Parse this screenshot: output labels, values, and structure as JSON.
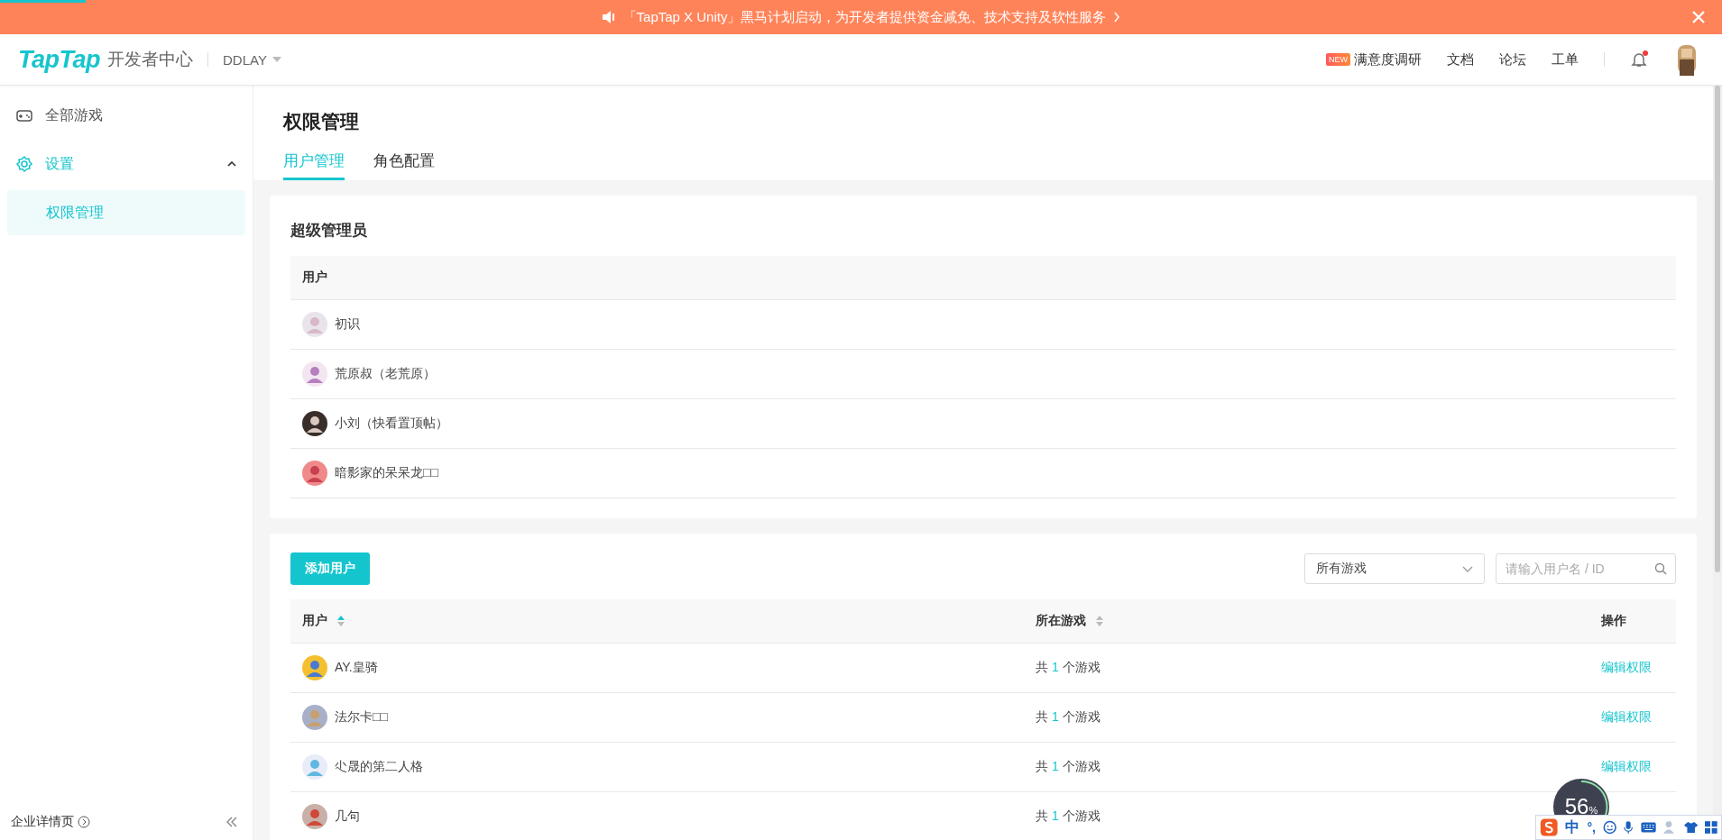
{
  "loading_bar": {
    "level": 0.05
  },
  "banner": {
    "text": "「TapTap X Unity」黑马计划启动，为开发者提供资金减免、技术支持及软性服务"
  },
  "header": {
    "logo": "TapTap",
    "subtitle": "开发者中心",
    "account": "DDLAY",
    "nav": [
      {
        "label": "满意度调研",
        "badge": "NEW"
      },
      {
        "label": "文档"
      },
      {
        "label": "论坛"
      },
      {
        "label": "工单"
      }
    ],
    "notification_dot": true
  },
  "sidebar": {
    "items": [
      {
        "label": "全部游戏",
        "kind": "link",
        "selected": false
      },
      {
        "label": "设置",
        "kind": "group",
        "selected": true,
        "expanded": true,
        "children": [
          {
            "label": "权限管理",
            "selected": true
          }
        ]
      }
    ],
    "footer": "企业详情页"
  },
  "page": {
    "title": "权限管理",
    "tabs": [
      {
        "label": "用户管理",
        "selected": true
      },
      {
        "label": "角色配置",
        "selected": false
      }
    ]
  },
  "super_admins": {
    "title": "超级管理员",
    "column": "用户",
    "rows": [
      {
        "name": "初识"
      },
      {
        "name": "荒原叔（老荒原）"
      },
      {
        "name": "小刘（快看置顶帖）"
      },
      {
        "name": "暗影家的呆呆龙□□"
      }
    ]
  },
  "users": {
    "add_button": "添加用户",
    "game_filter": "所有游戏",
    "search": {
      "placeholder": "请输入用户名 / ID"
    },
    "columns": [
      {
        "label": "用户",
        "sortable": true,
        "sorted_ascending": true
      },
      {
        "label": "所在游戏",
        "sortable": true,
        "sorted_ascending": false
      },
      {
        "label": "操作"
      }
    ],
    "rows": [
      {
        "name": "AY.皇骑",
        "games_prefix": "共",
        "games_count": "1",
        "games_suffix": "个游戏",
        "action": "编辑权限"
      },
      {
        "name": "法尔卡□□",
        "games_prefix": "共",
        "games_count": "1",
        "games_suffix": "个游戏",
        "action": "编辑权限"
      },
      {
        "name": "尐晟的第二人格",
        "games_prefix": "共",
        "games_count": "1",
        "games_suffix": "个游戏",
        "action": "编辑权限"
      },
      {
        "name": "几句",
        "games_prefix": "共",
        "games_count": "1",
        "games_suffix": "个游戏"
      }
    ]
  },
  "overlays": {
    "gauge": {
      "value": "56",
      "unit": "%"
    },
    "ime": {
      "mode": "中",
      "punct": "°,"
    }
  }
}
